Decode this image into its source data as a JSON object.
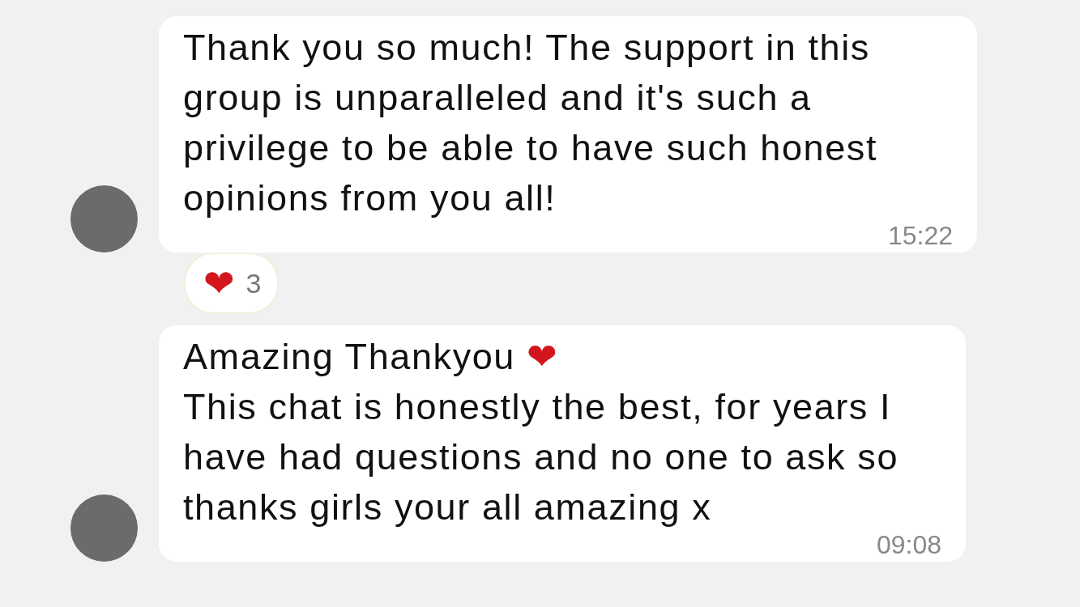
{
  "messages": [
    {
      "lines": [
        {
          "text": "Thank you so much! The support in this group is unparalleled and it's such a privilege to be able to have such honest opinions from you all!"
        }
      ],
      "time": "15:22",
      "reaction": {
        "emoji": "❤",
        "count": "3"
      }
    },
    {
      "lines": [
        {
          "text": "Amazing Thankyou",
          "emoji": "❤"
        },
        {
          "text": "This chat is honestly the best, for years I have had questions and no one to ask so thanks girls your all amazing x"
        }
      ],
      "time": "09:08"
    }
  ]
}
